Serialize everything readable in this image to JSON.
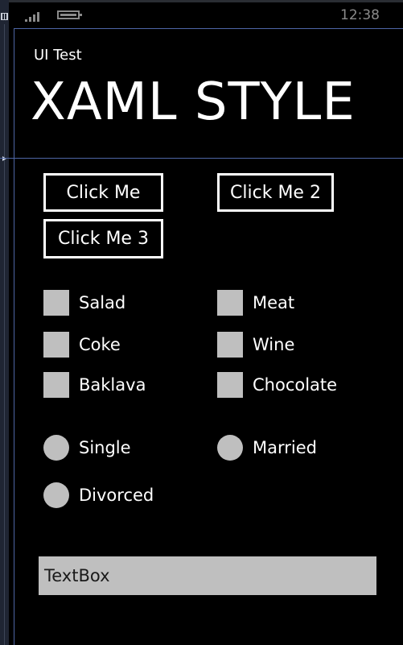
{
  "status_bar": {
    "time": "12:38"
  },
  "header": {
    "app_title": "UI Test",
    "page_title": "XAML STYLE"
  },
  "buttons": [
    {
      "label": "Click Me"
    },
    {
      "label": "Click Me 2"
    },
    {
      "label": "Click Me 3"
    }
  ],
  "checkboxes": [
    {
      "label": "Salad",
      "checked": false
    },
    {
      "label": "Meat",
      "checked": false
    },
    {
      "label": "Coke",
      "checked": false
    },
    {
      "label": "Wine",
      "checked": false
    },
    {
      "label": "Baklava",
      "checked": false
    },
    {
      "label": "Chocolate",
      "checked": false
    }
  ],
  "radios": [
    {
      "label": "Single",
      "selected": false
    },
    {
      "label": "Married",
      "selected": false
    },
    {
      "label": "Divorced",
      "selected": false
    }
  ],
  "textbox": {
    "value": "TextBox"
  },
  "colors": {
    "background": "#000000",
    "foreground": "#ffffff",
    "control_fill": "#bfbfbf",
    "designer_guide": "#4e66a5",
    "status_text": "#8a8a8a"
  }
}
